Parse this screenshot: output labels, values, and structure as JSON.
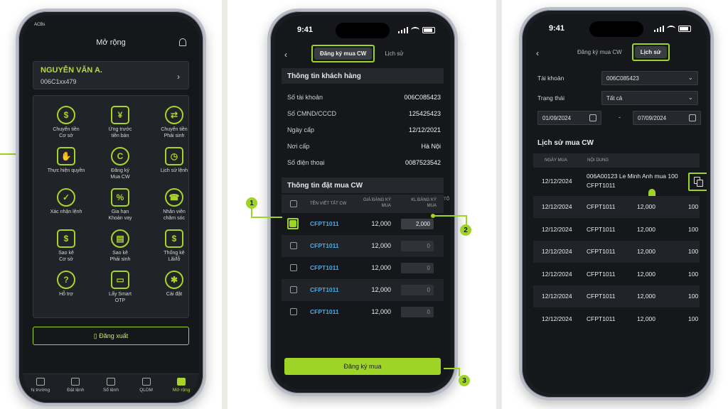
{
  "colors": {
    "accent": "#9dd425",
    "link": "#4ea9dc",
    "screen_bg": "#15171b"
  },
  "phone1": {
    "carrier": "ACBs",
    "title": "Mở rộng",
    "user": {
      "name": "NGUYỄN VĂN A.",
      "account": "006C1xx479"
    },
    "items": [
      {
        "label": [
          "Chuyển tiền",
          "Cơ sở"
        ],
        "icon": "dollar-coin-icon"
      },
      {
        "label": [
          "Ứng trước",
          "tiền bán"
        ],
        "icon": "cash-hand-icon"
      },
      {
        "label": [
          "Chuyển tiền",
          "Phái sinh"
        ],
        "icon": "transfer-icon"
      },
      {
        "label": [
          "Thực hiện quyền"
        ],
        "icon": "hand-icon"
      },
      {
        "label": [
          "Đăng ký",
          "Mua CW"
        ],
        "icon": "cw-register-icon"
      },
      {
        "label": [
          "Lịch sử lệnh"
        ],
        "icon": "clock-icon"
      },
      {
        "label": [
          "Xác nhận lệnh"
        ],
        "icon": "check-icon"
      },
      {
        "label": [
          "Gia hạn",
          "Khoản vay"
        ],
        "icon": "loan-icon"
      },
      {
        "label": [
          "Nhân viên",
          "chăm sóc"
        ],
        "icon": "support-icon"
      },
      {
        "label": [
          "Sao kê",
          "Cơ sở"
        ],
        "icon": "statement-icon"
      },
      {
        "label": [
          "Sao kê",
          "Phái sinh"
        ],
        "icon": "statement-derivative-icon"
      },
      {
        "label": [
          "Thống kê",
          "Lãi/lỗ"
        ],
        "icon": "profit-icon"
      },
      {
        "label": [
          "Hỗ trợ"
        ],
        "icon": "help-icon"
      },
      {
        "label": [
          "Lấy Smart",
          "OTP"
        ],
        "icon": "otp-icon"
      },
      {
        "label": [
          "Cài đặt"
        ],
        "icon": "gear-icon"
      }
    ],
    "logout": "Đăng xuất",
    "tabs": [
      "hị trường",
      "Đặt lệnh",
      "Sổ lệnh",
      "QLDM",
      "Mở rộng"
    ]
  },
  "phone2": {
    "time": "9:41",
    "tab_active": "Đăng ký mua CW",
    "tab_other": "Lịch sử",
    "customer_section": "Thông tin khách hàng",
    "info": [
      {
        "k": "Số tài khoản",
        "v": "006C085423"
      },
      {
        "k": "Số CMND/CCCD",
        "v": "125425423"
      },
      {
        "k": "Ngày cấp",
        "v": "12/12/2021"
      },
      {
        "k": "Nơi cấp",
        "v": "Hà Nội"
      },
      {
        "k": "Số điện thoại",
        "v": "0087523542"
      }
    ],
    "order_section": "Thông tin đặt mua CW",
    "table_head": {
      "code": "TÊN VIẾT TẮT CW",
      "price": "GIÁ ĐĂNG KÝ MUA",
      "qty": "KL ĐĂNG KÝ MUA",
      "extra": "TỔ"
    },
    "rows": [
      {
        "code": "CFPT1011",
        "price": "12,000",
        "qty": "2,000",
        "checked": true
      },
      {
        "code": "CFPT1011",
        "price": "12,000",
        "qty": "0",
        "checked": false
      },
      {
        "code": "CFPT1011",
        "price": "12,000",
        "qty": "0",
        "checked": false
      },
      {
        "code": "CFPT1011",
        "price": "12,000",
        "qty": "0",
        "checked": false
      },
      {
        "code": "CFPT1011",
        "price": "12,000",
        "qty": "0",
        "checked": false
      }
    ],
    "submit": "Đăng ký mua",
    "callouts": [
      "1",
      "2",
      "3"
    ]
  },
  "phone3": {
    "time": "9:41",
    "tab_other": "Đăng ký mua CW",
    "tab_active": "Lịch sử",
    "account_label": "Tài khoản",
    "account_value": "006C085423",
    "status_label": "Trạng thái",
    "status_value": "Tất cả",
    "date_from": "01/09/2024",
    "date_sep": "-",
    "date_to": "07/09/2024",
    "history_title": "Lịch sử mua CW",
    "head": {
      "date": "NGÀY MUA",
      "content": "NỘI DUNG"
    },
    "first_row": {
      "date": "12/12/2024",
      "content_1": "006A00123 Le Minh Anh mua 100",
      "content_2": "CFPT1011"
    },
    "rows": [
      {
        "date": "12/12/2024",
        "code": "CFPT1011",
        "price": "12,000",
        "qty": "100"
      },
      {
        "date": "12/12/2024",
        "code": "CFPT1011",
        "price": "12,000",
        "qty": "100"
      },
      {
        "date": "12/12/2024",
        "code": "CFPT1011",
        "price": "12,000",
        "qty": "100"
      },
      {
        "date": "12/12/2024",
        "code": "CFPT1011",
        "price": "12,000",
        "qty": "100"
      },
      {
        "date": "12/12/2024",
        "code": "CFPT1011",
        "price": "12,000",
        "qty": "100"
      },
      {
        "date": "12/12/2024",
        "code": "CFPT1011",
        "price": "12,000",
        "qty": "100"
      }
    ]
  }
}
